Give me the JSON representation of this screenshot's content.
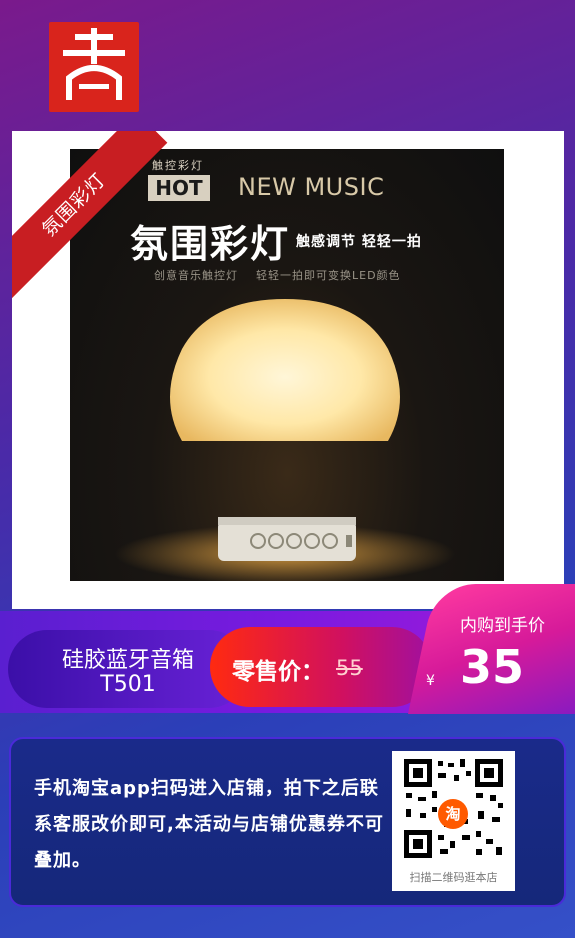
{
  "logo": {
    "glyph": "吉",
    "color": "#d9241c"
  },
  "ribbon": {
    "text": "氛围彩灯",
    "color": "#cc1f24"
  },
  "photo": {
    "small_label": "触控彩灯",
    "hot": "HOT",
    "new_music": "NEW MUSIC",
    "big_title": "氛围彩灯",
    "touch_text": "触感调节  轻轻一拍",
    "sub_text": "创意音乐触控灯    轻轻一拍即可变换LED颜色"
  },
  "product": {
    "name_line1": "硅胶蓝牙音箱",
    "name_line2": "T501"
  },
  "retail": {
    "label": "零售价：",
    "price": "55"
  },
  "inner": {
    "title": "内购到手价",
    "currency": "¥",
    "price": "35"
  },
  "info": {
    "text": "手机淘宝app扫码进入店铺，拍下之后联系客服改价即可,本活动与店铺优惠券不可叠加。"
  },
  "qr": {
    "caption": "扫描二维码逛本店",
    "badge": "淘"
  }
}
